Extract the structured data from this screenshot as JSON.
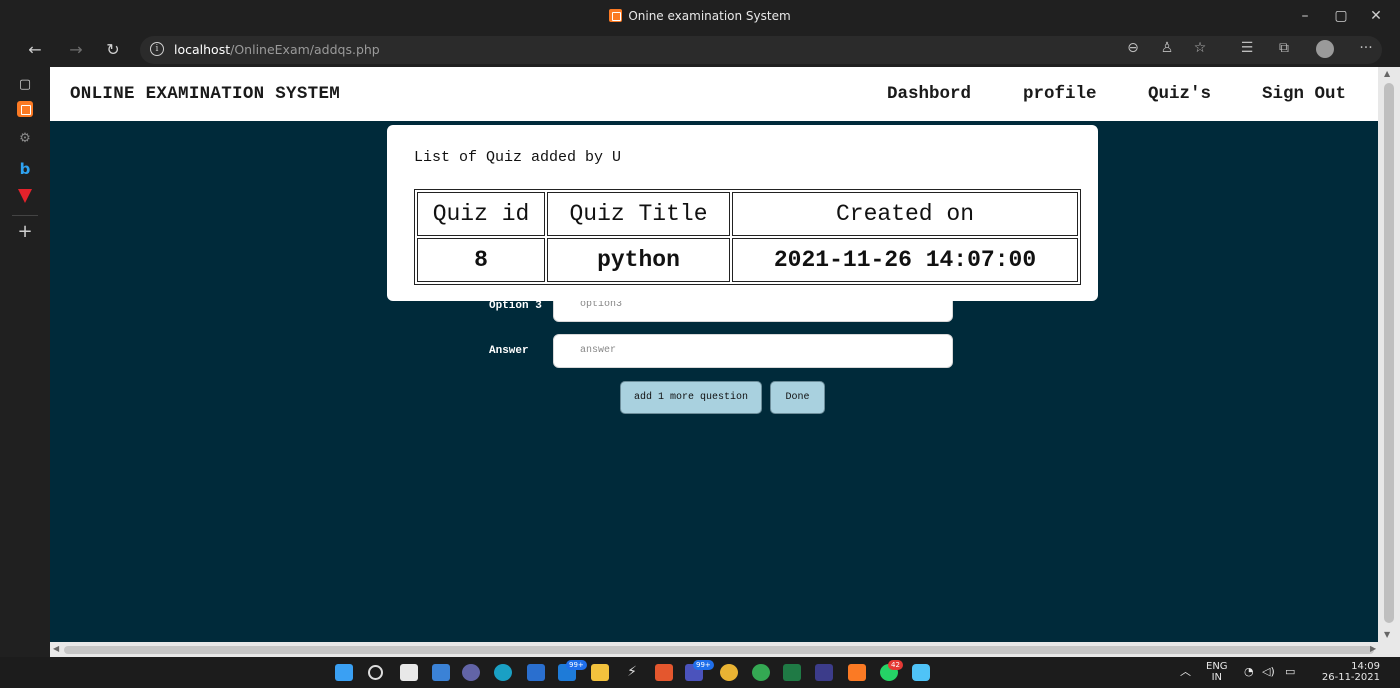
{
  "window": {
    "title": "Onine examination System",
    "controls": {
      "minimize": "–",
      "restore": "▢",
      "close": "✕"
    }
  },
  "browser": {
    "url_host": "localhost",
    "url_path": "/OnlineExam/addqs.php",
    "nav": {
      "back": "←",
      "forward": "→",
      "refresh": "↻"
    },
    "toolbar_icons": [
      "zoom-icon",
      "profile-share-icon",
      "favorite-add-icon",
      "favorites-icon",
      "collections-icon",
      "profile-icon",
      "more-icon"
    ]
  },
  "site": {
    "brand": "ONLINE EXAMINATION SYSTEM",
    "menu": {
      "dashboard": "Dashbord",
      "profile": "profile",
      "quizzes": "Quiz's",
      "signout": "Sign Out"
    }
  },
  "form": {
    "option3_label": "Option 3",
    "option3_placeholder": "option3",
    "answer_label": "Answer",
    "answer_placeholder": "answer",
    "add_more_button": "add 1 more question",
    "done_button": "Done"
  },
  "modal": {
    "caption": "List of Quiz added by U",
    "headers": [
      "Quiz id",
      "Quiz Title",
      "Created on"
    ],
    "rows": [
      {
        "id": "8",
        "title": "python",
        "created": "2021-11-26 14:07:00"
      }
    ]
  },
  "taskbar": {
    "badges": {
      "mail": "99+",
      "teams": "99+",
      "whatsapp": "42"
    },
    "language": "ENG",
    "region": "IN",
    "time": "14:09",
    "date": "26-11-2021"
  },
  "colors": {
    "page_bg": "#002a3a",
    "button_bg": "#a9d1df",
    "xampp_orange": "#fb7a24"
  }
}
